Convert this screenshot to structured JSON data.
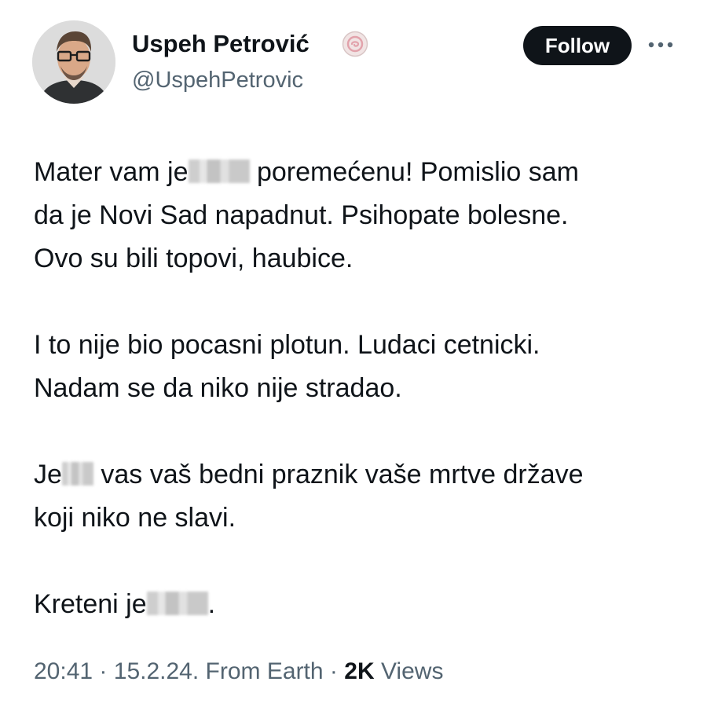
{
  "author": {
    "display_name": "Uspeh Petrović",
    "handle": "@UspehPetrovic",
    "avatar_icon": "profile-photo",
    "badge_icon": "verified-badge-icon"
  },
  "actions": {
    "follow_label": "Follow",
    "more_icon": "more-options-icon"
  },
  "tweet": {
    "p1": {
      "l1a": "Mater vam je",
      "l1b": " poremećenu! Pomislio sam",
      "l2": "da je Novi Sad napadnut. Psihopate bolesne.",
      "l3": "Ovo su bili topovi, haubice."
    },
    "p2": {
      "l1": "I to nije bio pocasni plotun. Ludaci cetnicki.",
      "l2": "Nadam se da niko nije stradao."
    },
    "p3": {
      "l1a": "Je",
      "l1b": " vas vaš bedni praznik vaše mrtve države",
      "l2": "koji niko ne slavi."
    },
    "p4": {
      "l1a": "Kreteni je",
      "l1b": "."
    }
  },
  "meta": {
    "time": "20:41",
    "date": "15.2.24.",
    "source": "From Earth",
    "views_count": "2K",
    "views_label": "Views",
    "separator": "·"
  },
  "colors": {
    "text": "#0f1419",
    "muted": "#536471",
    "follow_bg": "#0f1419",
    "badge": "#e4a0a8"
  }
}
